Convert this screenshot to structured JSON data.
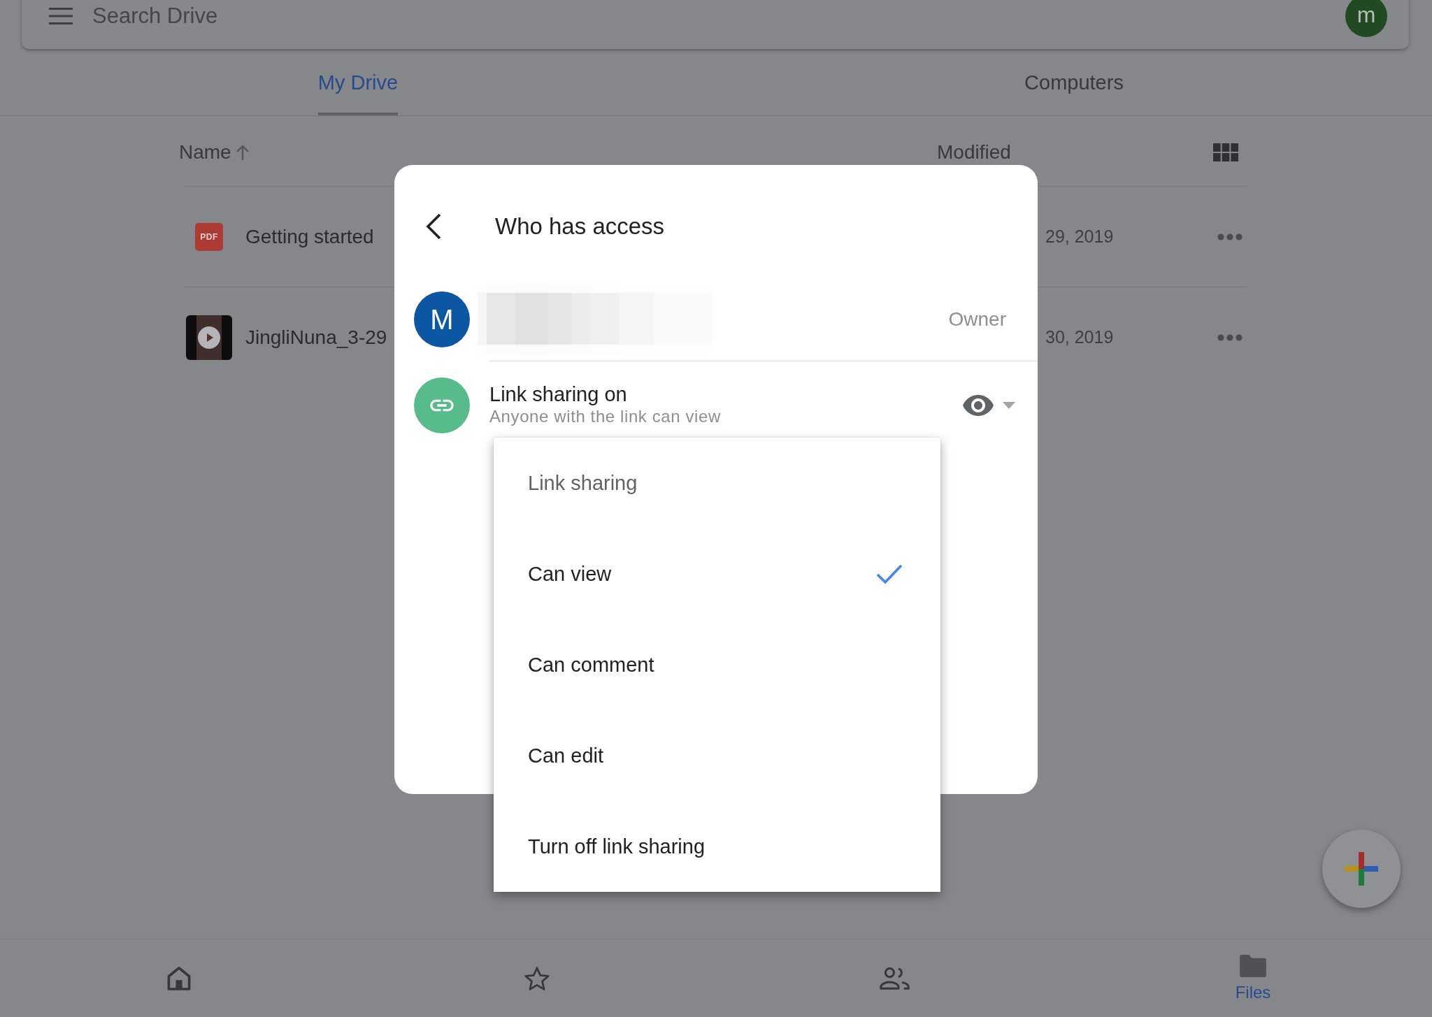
{
  "app_bar": {
    "search": {
      "placeholder": "Search Drive"
    },
    "avatar_letter": "m"
  },
  "tabs": [
    {
      "label": "My Drive",
      "selected": true
    },
    {
      "label": "Computers",
      "selected": false
    }
  ],
  "file_list": {
    "columns": [
      {
        "label": "Name",
        "sorted": true
      },
      {
        "label": "Modified",
        "sorted": false
      }
    ],
    "rows": [
      {
        "kind": "pdf",
        "badge": "PDF",
        "name": "Getting started",
        "modified": "29, 2019"
      },
      {
        "kind": "video",
        "name": "JingliNuna_3-29",
        "modified": "30, 2019"
      }
    ]
  },
  "dialog": {
    "title": "Who has access",
    "owner": {
      "avatar_letter": "M",
      "role": "Owner"
    },
    "link_sharing": {
      "title": "Link sharing on",
      "subtitle": "Anyone with the link can view"
    }
  },
  "access_menu": {
    "heading": "Link sharing",
    "options": [
      {
        "label": "Can view",
        "selected": true
      },
      {
        "label": "Can comment",
        "selected": false
      },
      {
        "label": "Can edit",
        "selected": false
      },
      {
        "label": "Turn off link sharing",
        "selected": false
      }
    ]
  },
  "bottom_nav": [
    {
      "kind": "home",
      "selected": false
    },
    {
      "kind": "starred",
      "selected": false
    },
    {
      "kind": "shared",
      "selected": false
    },
    {
      "kind": "files",
      "label": "Files",
      "selected": true
    }
  ]
}
